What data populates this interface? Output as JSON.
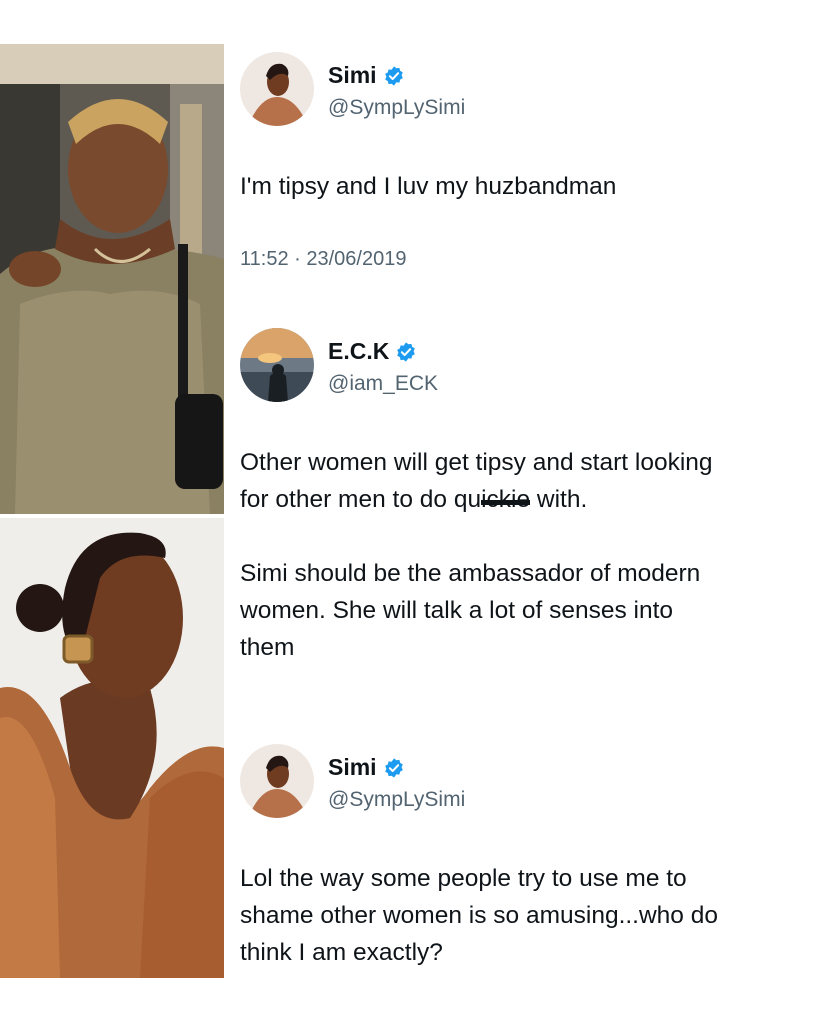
{
  "tweets": [
    {
      "name": "Simi",
      "handle": "@SympLySimi",
      "verified_icon": "verified-badge-icon",
      "text": "I'm tipsy and I luv my huzbandman",
      "timestamp": "11:52 · 23/06/2019"
    },
    {
      "name": "E.C.K",
      "handle": "@iam_ECK",
      "verified_icon": "verified-badge-icon",
      "text_line1_pre": "Other women will get tipsy and start looking\nfor other men to do qu",
      "text_line1_struck": "ickie",
      "text_line1_post": " with.",
      "text_para2": "Simi should be the ambassador of modern\nwomen. She will talk a lot of senses into\nthem"
    },
    {
      "name": "Simi",
      "handle": "@SympLySimi",
      "verified_icon": "verified-badge-icon",
      "text": "Lol the way some people try to use me to\nshame other women is so amusing...who do\nthink I am exactly?"
    }
  ],
  "colors": {
    "verified_blue": "#1d9bf0",
    "text_primary": "#0f1419",
    "text_secondary": "#536471"
  }
}
